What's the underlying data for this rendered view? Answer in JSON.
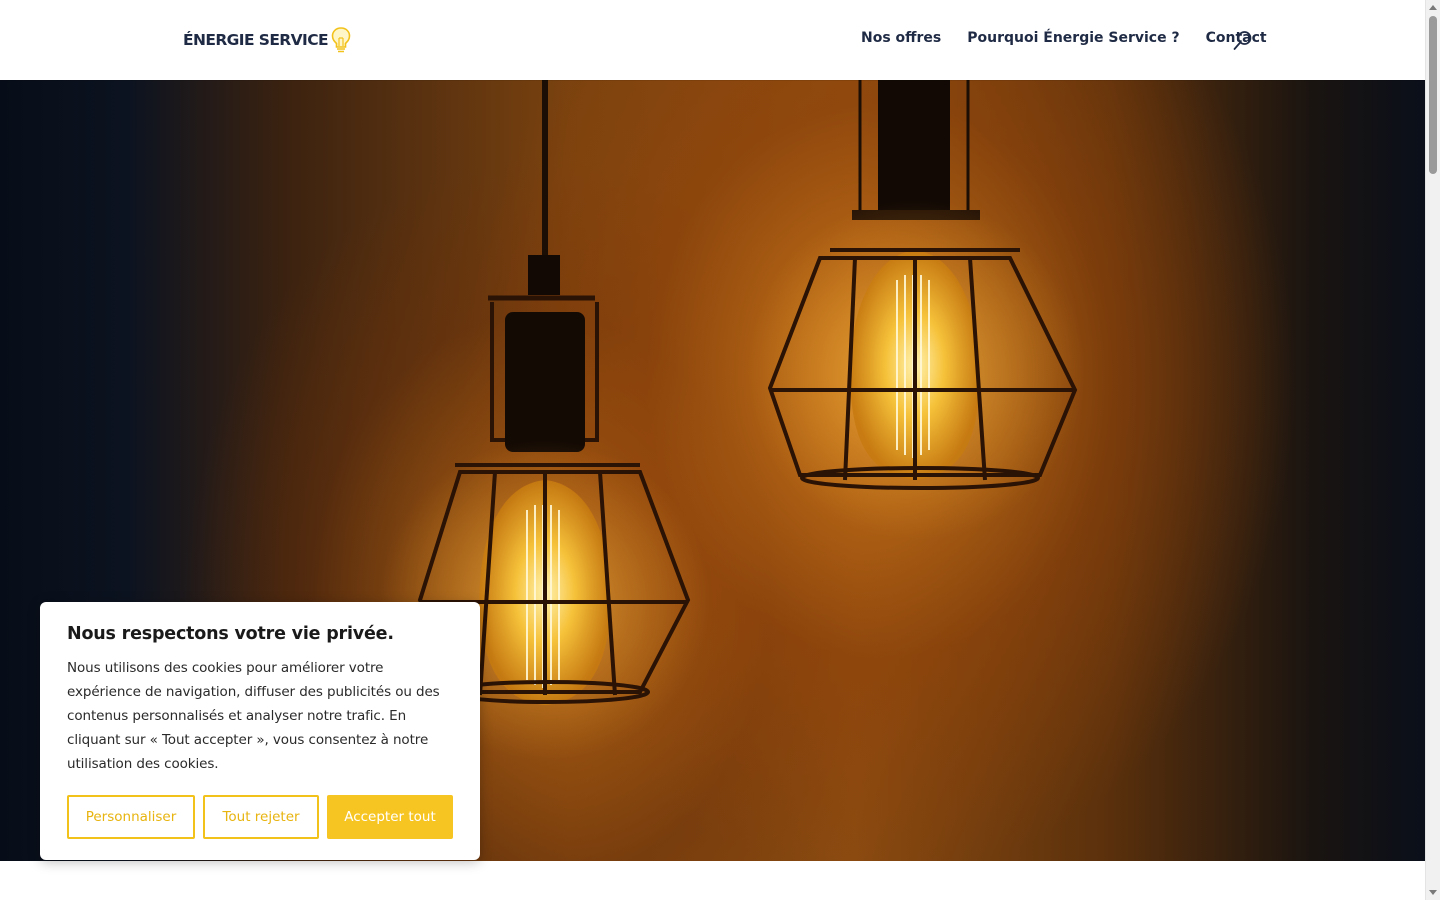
{
  "header": {
    "logo_text": "ÉNERGIE SERVICE",
    "nav": [
      "Nos offres",
      "Pourquoi Énergie Service ?",
      "Contact"
    ]
  },
  "cookie_banner": {
    "title": "Nous respectons votre vie privée.",
    "text": "Nous utilisons des cookies pour améliorer votre expérience de navigation, diffuser des publicités ou des contenus personnalisés et analyser notre trafic. En cliquant sur « Tout accepter », vous consentez à notre utilisation des cookies.",
    "buttons": {
      "customize": "Personnaliser",
      "reject": "Tout rejeter",
      "accept": "Accepter tout"
    }
  },
  "icons": {
    "logo": "lightbulb-icon",
    "search": "search-icon"
  },
  "colors": {
    "brand_dark": "#1f2a44",
    "accent_yellow": "#f7c521"
  }
}
